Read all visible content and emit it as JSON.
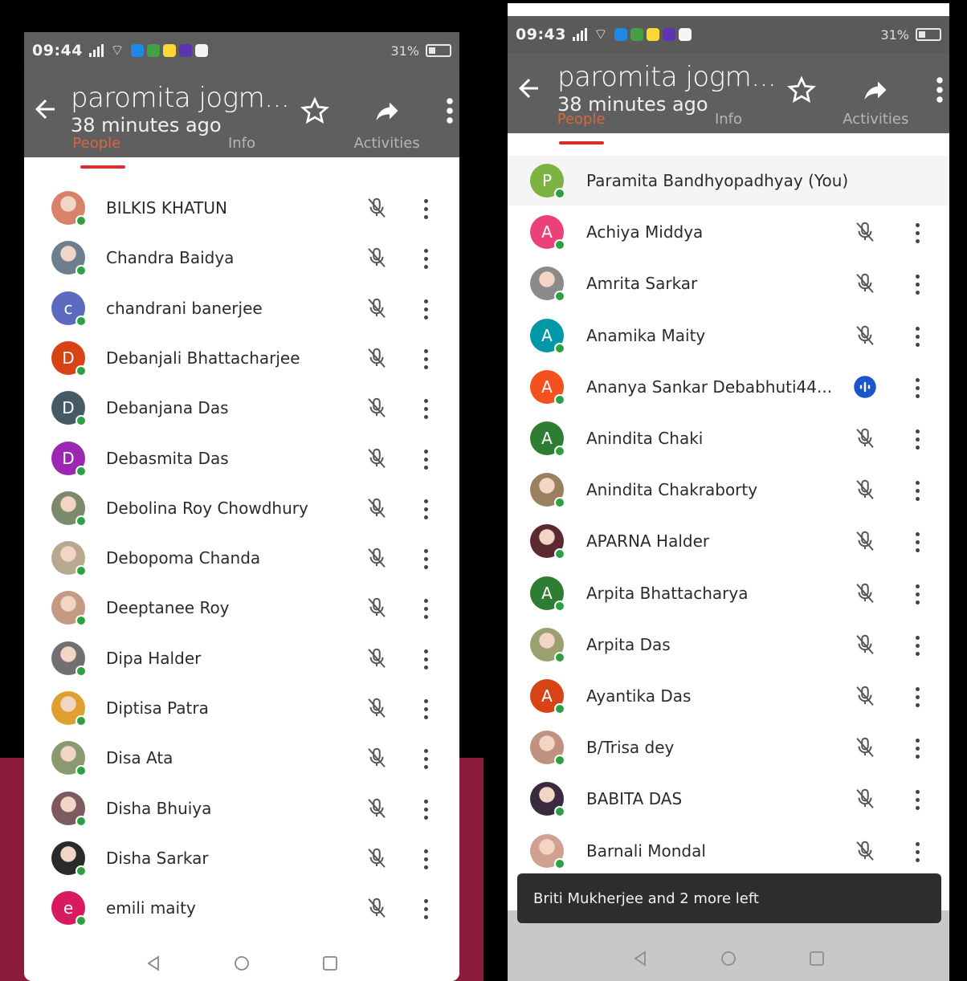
{
  "left": {
    "status_time": "09:44",
    "battery": "31%",
    "title": "paromita jogm...",
    "subtitle": "38 minutes ago",
    "tabs": [
      "People",
      "Info",
      "Activities"
    ],
    "participants": [
      {
        "name": "BILKIS KHATUN",
        "initial": "",
        "color": "#d9826a",
        "photo": true,
        "speaking": false
      },
      {
        "name": "Chandra Baidya",
        "initial": "",
        "color": "#6c7f8f",
        "photo": true,
        "speaking": false
      },
      {
        "name": "chandrani banerjee",
        "initial": "c",
        "color": "#5c6bc0",
        "photo": false,
        "speaking": false
      },
      {
        "name": "Debanjali Bhattacharjee",
        "initial": "D",
        "color": "#d84315",
        "photo": false,
        "speaking": false
      },
      {
        "name": "Debanjana Das",
        "initial": "D",
        "color": "#455a64",
        "photo": false,
        "speaking": false
      },
      {
        "name": "Debasmita Das",
        "initial": "D",
        "color": "#9c27b0",
        "photo": false,
        "speaking": false
      },
      {
        "name": "Debolina Roy Chowdhury",
        "initial": "",
        "color": "#7a8a6a",
        "photo": true,
        "speaking": false
      },
      {
        "name": "Debopoma Chanda",
        "initial": "",
        "color": "#b8a890",
        "photo": true,
        "speaking": false
      },
      {
        "name": "Deeptanee Roy",
        "initial": "",
        "color": "#c49a82",
        "photo": true,
        "speaking": false
      },
      {
        "name": "Dipa Halder",
        "initial": "",
        "color": "#707070",
        "photo": true,
        "speaking": false
      },
      {
        "name": "Diptisa Patra",
        "initial": "",
        "color": "#e0a030",
        "photo": true,
        "speaking": false
      },
      {
        "name": "Disa Ata",
        "initial": "",
        "color": "#8a9a70",
        "photo": true,
        "speaking": false
      },
      {
        "name": "Disha Bhuiya",
        "initial": "",
        "color": "#7c5a60",
        "photo": true,
        "speaking": false
      },
      {
        "name": "Disha Sarkar",
        "initial": "",
        "color": "#2a2a2a",
        "photo": true,
        "speaking": false
      },
      {
        "name": "emili maity",
        "initial": "e",
        "color": "#d81b60",
        "photo": false,
        "speaking": false
      }
    ]
  },
  "right": {
    "status_time": "09:43",
    "battery": "31%",
    "title": "paromita jogm...",
    "subtitle": "38 minutes ago",
    "tabs": [
      "People",
      "Info",
      "Activities"
    ],
    "participants": [
      {
        "name": "Paramita Bandhyopadhyay (You)",
        "initial": "P",
        "color": "#7cb342",
        "photo": false,
        "speaking": false,
        "self": true
      },
      {
        "name": "Achiya Middya",
        "initial": "A",
        "color": "#ec407a",
        "photo": false,
        "speaking": false
      },
      {
        "name": "Amrita Sarkar",
        "initial": "",
        "color": "#8a8a8a",
        "photo": true,
        "speaking": false
      },
      {
        "name": "Anamika Maity",
        "initial": "A",
        "color": "#0097a7",
        "photo": false,
        "speaking": false
      },
      {
        "name": "Ananya Sankar Debabhuti44...",
        "initial": "A",
        "color": "#f4511e",
        "photo": false,
        "speaking": true
      },
      {
        "name": "Anindita Chaki",
        "initial": "A",
        "color": "#2e7d32",
        "photo": false,
        "speaking": false
      },
      {
        "name": "Anindita Chakraborty",
        "initial": "",
        "color": "#9a8060",
        "photo": true,
        "speaking": false
      },
      {
        "name": "APARNA Halder",
        "initial": "",
        "color": "#5a2a30",
        "photo": true,
        "speaking": false
      },
      {
        "name": "Arpita Bhattacharya",
        "initial": "A",
        "color": "#2e7d32",
        "photo": false,
        "speaking": false
      },
      {
        "name": "Arpita Das",
        "initial": "",
        "color": "#9aa070",
        "photo": true,
        "speaking": false
      },
      {
        "name": "Ayantika Das",
        "initial": "A",
        "color": "#d84315",
        "photo": false,
        "speaking": false
      },
      {
        "name": "B/Trisa dey",
        "initial": "",
        "color": "#c09080",
        "photo": true,
        "speaking": false
      },
      {
        "name": "BABITA DAS",
        "initial": "",
        "color": "#3a2a40",
        "photo": true,
        "speaking": false
      },
      {
        "name": "Barnali Mondal",
        "initial": "",
        "color": "#d0a090",
        "photo": true,
        "speaking": false
      }
    ],
    "toast": "Briti Mukherjee and 2 more left"
  }
}
